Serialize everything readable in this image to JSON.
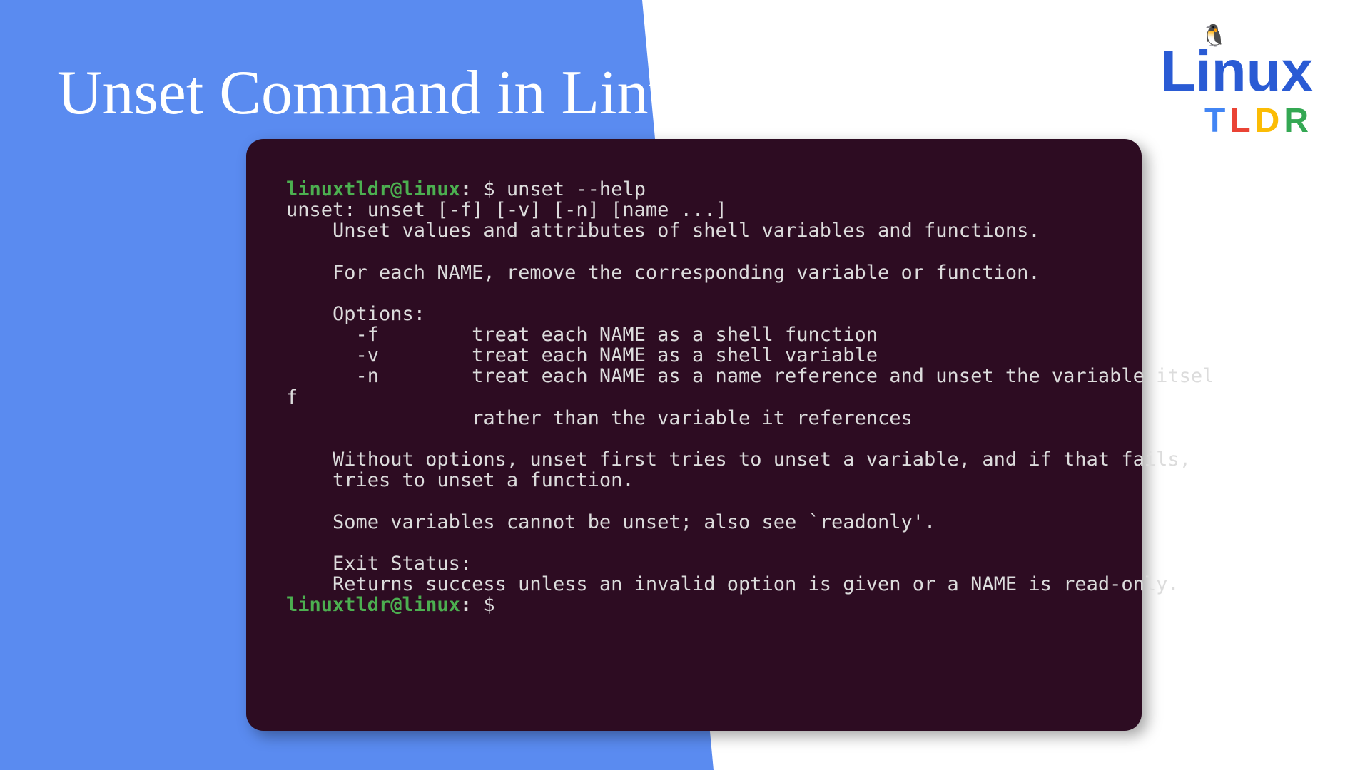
{
  "title": "Unset Command in Linux",
  "logo": {
    "linux": "Linux",
    "tldr_T": "T",
    "tldr_L": "L",
    "tldr_D": "D",
    "tldr_R": "R"
  },
  "terminal": {
    "prompt_user": "linuxtldr@linux",
    "prompt_sep": ":",
    "prompt_dollar": " $ ",
    "command": "unset --help",
    "output_1": "unset: unset [-f] [-v] [-n] [name ...]",
    "output_2": "    Unset values and attributes of shell variables and functions.",
    "output_3": "    ",
    "output_4": "    For each NAME, remove the corresponding variable or function.",
    "output_5": "    ",
    "output_6": "    Options:",
    "output_7": "      -f        treat each NAME as a shell function",
    "output_8": "      -v        treat each NAME as a shell variable",
    "output_9": "      -n        treat each NAME as a name reference and unset the variable itsel",
    "output_10": "f",
    "output_11": "                rather than the variable it references",
    "output_12": "    ",
    "output_13": "    Without options, unset first tries to unset a variable, and if that fails,",
    "output_14": "    tries to unset a function.",
    "output_15": "    ",
    "output_16": "    Some variables cannot be unset; also see `readonly'.",
    "output_17": "    ",
    "output_18": "    Exit Status:",
    "output_19": "    Returns success unless an invalid option is given or a NAME is read-only."
  }
}
